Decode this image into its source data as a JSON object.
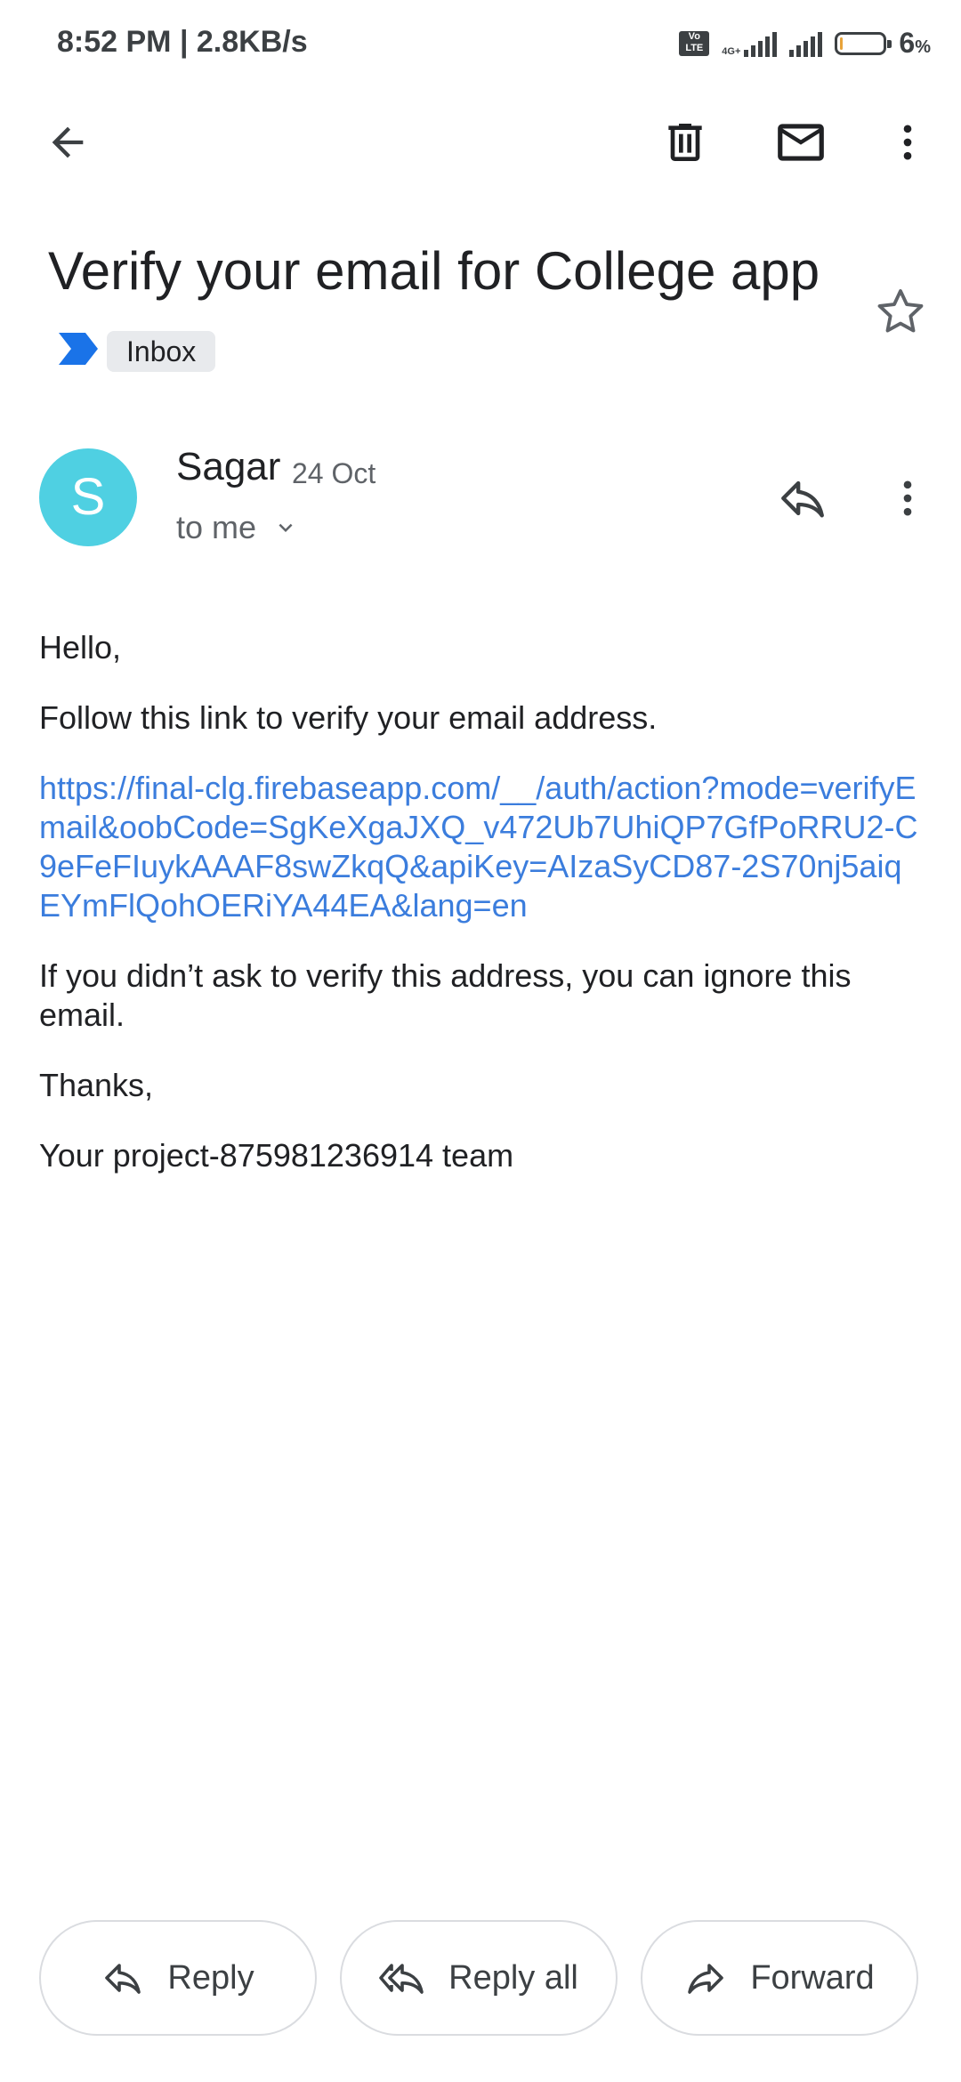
{
  "status_bar": {
    "time_and_speed": "8:52 PM | 2.8KB/s",
    "volte_label": "Vo LTE",
    "network_type": "4G+",
    "battery_percent": "6",
    "battery_unit": "%",
    "battery_level": 0.06
  },
  "toolbar": {
    "back_icon": "arrow-back-icon",
    "delete_icon": "trash-icon",
    "mark_unread_icon": "mail-icon",
    "more_icon": "more-vert-icon"
  },
  "email": {
    "subject": "Verify your email for College app",
    "label": "Inbox",
    "starred": false,
    "sender": {
      "initial": "S",
      "name": "Sagar",
      "date": "24 Oct",
      "recipient": "to me",
      "avatar_color": "#4fd0e2"
    },
    "body": {
      "greeting": "Hello,",
      "instruction": "Follow this link to verify your email address.",
      "link": "https://final-clg.firebaseapp.com/__/auth/action?mode=verifyEmail&oobCode=SgKeXgaJXQ_v472Ub7UhiQP7GfPoRRU2-C9eFeFIuykAAAF8swZkqQ&apiKey=AIzaSyCD87-2S70nj5aiqEYmFlQohOERiYA44EA&lang=en",
      "ignore_note": "If you didn’t ask to verify this address, you can ignore this email.",
      "signoff": "Thanks,",
      "signature": "Your project-875981236914 team"
    }
  },
  "actions": {
    "reply_label": "Reply",
    "reply_all_label": "Reply all",
    "forward_label": "Forward"
  },
  "colors": {
    "link": "#3b7ddd",
    "important_marker": "#1a73e8",
    "battery_low": "#e8a33a"
  }
}
